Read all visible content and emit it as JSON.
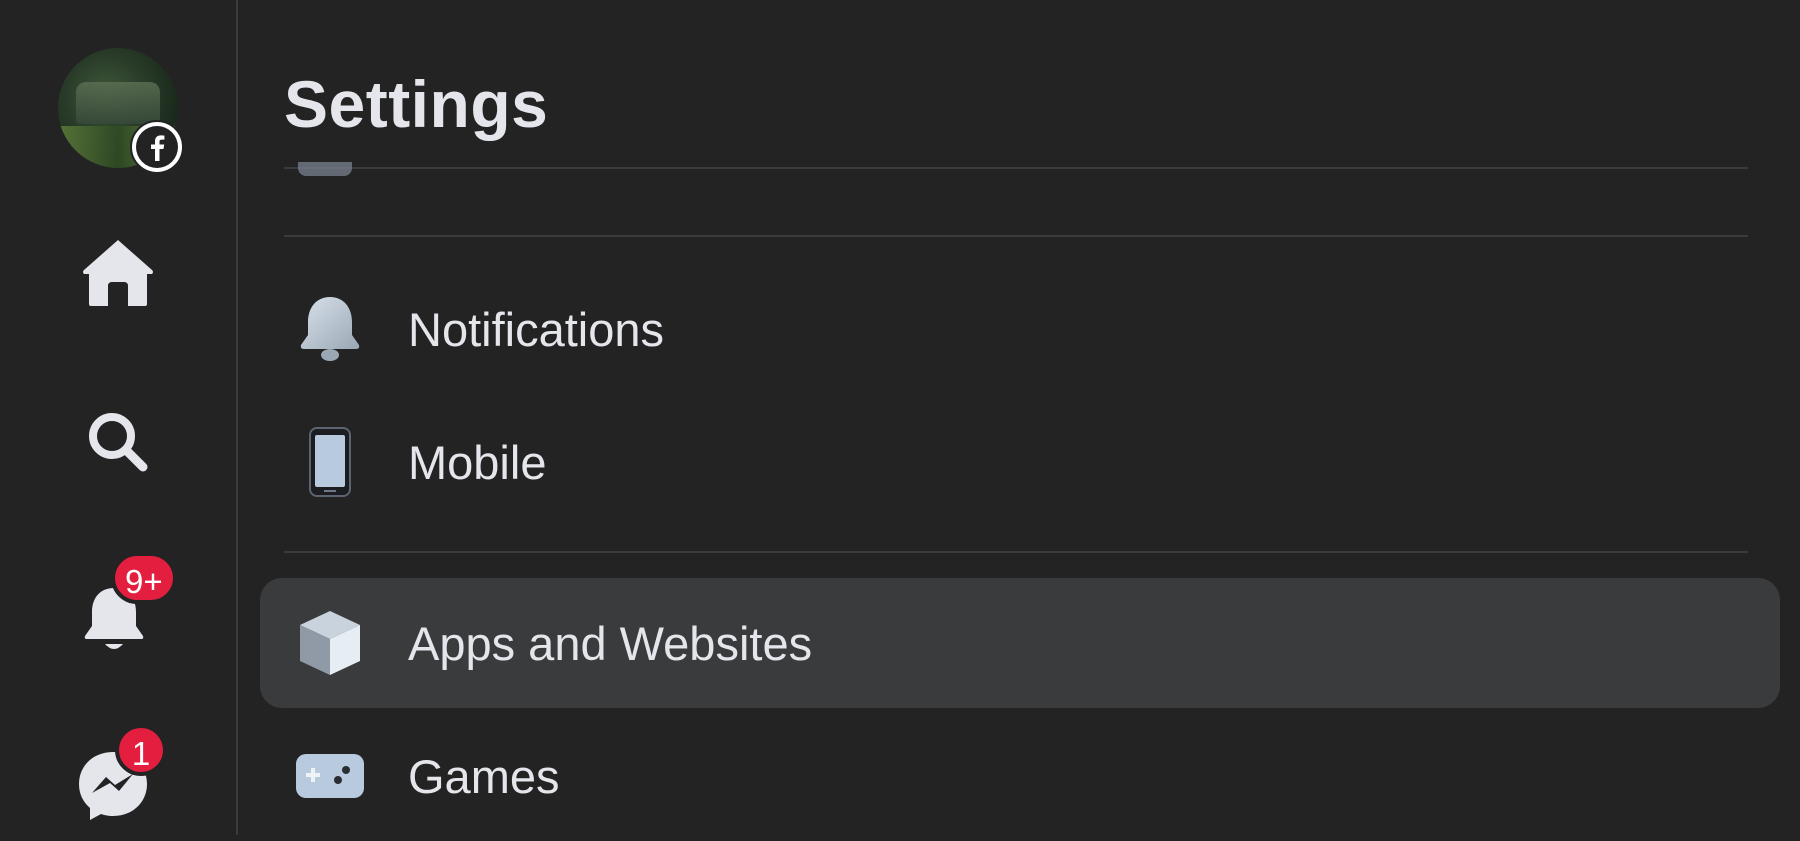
{
  "rail": {
    "profile": {
      "avatar_icon": "profile-avatar",
      "badge_icon": "facebook-logo-icon"
    },
    "home_icon": "home-icon",
    "search_icon": "search-icon",
    "notifications": {
      "icon": "bell-icon",
      "badge": "9+"
    },
    "messenger": {
      "icon": "messenger-icon",
      "badge": "1"
    }
  },
  "settings": {
    "title": "Settings",
    "items": [
      {
        "label": "Notifications",
        "icon": "bell-icon",
        "selected": false
      },
      {
        "label": "Mobile",
        "icon": "mobile-phone-icon",
        "selected": false
      },
      {
        "label": "Apps and Websites",
        "icon": "cube-icon",
        "selected": true
      },
      {
        "label": "Games",
        "icon": "game-controller-icon",
        "selected": false
      }
    ]
  },
  "colors": {
    "background": "#232324",
    "selected_row": "#3a3b3c",
    "text": "#e4e6eb",
    "badge": "#e41e3f",
    "divider": "#3a3b3c"
  }
}
